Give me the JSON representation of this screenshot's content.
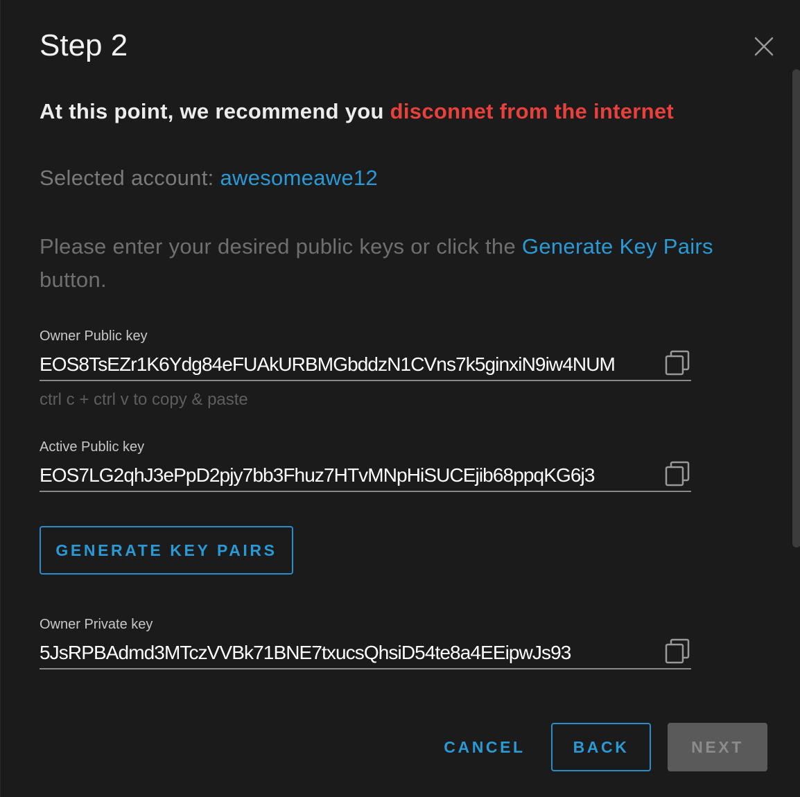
{
  "dialog": {
    "title": "Step 2",
    "warning_prefix": "At this point, we recommend you ",
    "warning_highlight": "disconnet from the internet",
    "selected_prefix": "Selected account: ",
    "selected_account": "awesomeawe12",
    "instructions_prefix": "Please enter your desired public keys or click the ",
    "instructions_link": "Generate Key Pairs",
    "instructions_suffix": " button."
  },
  "fields": {
    "owner_public": {
      "label": "Owner Public key",
      "value": "EOS8TsEZr1K6Ydg84eFUAkURBMGbddzN1CVns7k5ginxiN9iw4NUM",
      "hint": "ctrl c + ctrl v to copy & paste"
    },
    "active_public": {
      "label": "Active Public key",
      "value": "EOS7LG2qhJ3ePpD2pjy7bb3Fhuz7HTvMNpHiSUCEjib68ppqKG6j3"
    },
    "owner_private": {
      "label": "Owner Private key",
      "value": "5JsRPBAdmd3MTczVVBk71BNE7txucsQhsiD54te8a4EEipwJs93"
    }
  },
  "buttons": {
    "generate": "GENERATE KEY PAIRS",
    "cancel": "CANCEL",
    "back": "BACK",
    "next": "NEXT"
  },
  "icons": {
    "close": "close-icon",
    "copy": "copy-icon"
  },
  "colors": {
    "background": "#1b1b1b",
    "accent_blue": "#2a9ad6",
    "warning_red": "#e8413c",
    "disabled_button": "#5a5a5a"
  }
}
